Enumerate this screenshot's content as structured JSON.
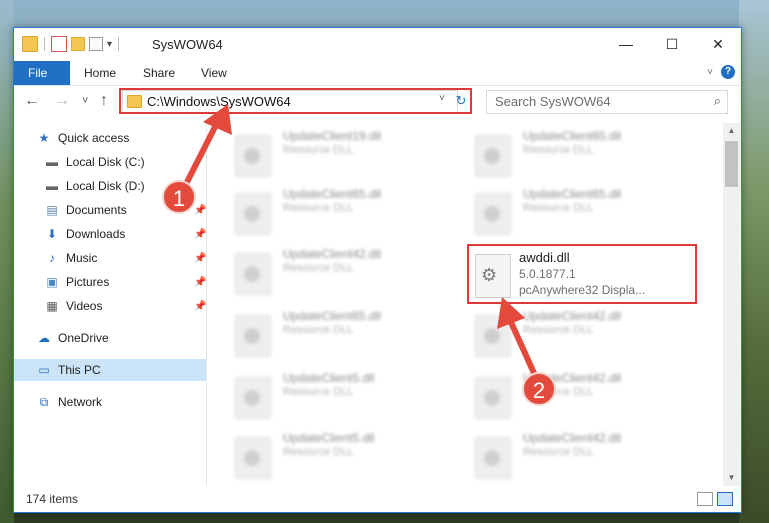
{
  "window": {
    "title": "SysWOW64",
    "controls": {
      "minimize": "—",
      "maximize": "☐",
      "close": "✕"
    }
  },
  "ribbon": {
    "tabs": [
      {
        "label": "File"
      },
      {
        "label": "Home"
      },
      {
        "label": "Share"
      },
      {
        "label": "View"
      }
    ],
    "help": "?"
  },
  "navigation": {
    "back": "←",
    "forward": "→",
    "recent": "˅",
    "up": "↑",
    "address": "C:\\Windows\\SysWOW64",
    "address_dropdown": "˅",
    "refresh": "↻",
    "search_placeholder": "Search SysWOW64",
    "search_icon": "⌕"
  },
  "sidebar": {
    "items": [
      {
        "label": "Quick access",
        "icon": "star-icon"
      },
      {
        "label": "Local Disk (C:)",
        "icon": "drive-icon"
      },
      {
        "label": "Local Disk (D:)",
        "icon": "drive-icon"
      },
      {
        "label": "Documents",
        "icon": "documents-icon"
      },
      {
        "label": "Downloads",
        "icon": "downloads-icon"
      },
      {
        "label": "Music",
        "icon": "music-icon"
      },
      {
        "label": "Pictures",
        "icon": "pictures-icon"
      },
      {
        "label": "Videos",
        "icon": "videos-icon"
      },
      {
        "label": "OneDrive",
        "icon": "onedrive-icon"
      },
      {
        "label": "This PC",
        "icon": "pc-icon"
      },
      {
        "label": "Network",
        "icon": "network-icon"
      }
    ]
  },
  "files": {
    "left_column": [
      {
        "name": "UpdateClient19.dll",
        "type": "Resource DLL"
      },
      {
        "name": "UpdateClient65.dll",
        "type": "Resource DLL"
      },
      {
        "name": "UpdateClient42.dll",
        "type": "Resource DLL"
      },
      {
        "name": "UpdateClient65.dll",
        "type": "Resource DLL"
      },
      {
        "name": "UpdateClient5.dll",
        "type": "Resource DLL"
      },
      {
        "name": "UpdateClient5.dll",
        "type": "Resource DLL"
      }
    ],
    "right_column": [
      {
        "name": "UpdateClient65.dll",
        "type": "Resource DLL"
      },
      {
        "name": "UpdateClient65.dll",
        "type": "Resource DLL"
      },
      {
        "name": "UpdateClient42.dll",
        "type": "Resource DLL"
      },
      {
        "name": "UpdateClient42.dll",
        "type": "Resource DLL"
      },
      {
        "name": "UpdateClient42.dll",
        "type": "Resource DLL"
      }
    ],
    "highlighted": {
      "name": "awddi.dll",
      "version": "5.0.1877.1",
      "description": "pcAnywhere32 Displa..."
    }
  },
  "status": {
    "item_count": "174 items"
  },
  "annotations": {
    "step1": "1",
    "step2": "2",
    "color": "#e34a3c"
  }
}
